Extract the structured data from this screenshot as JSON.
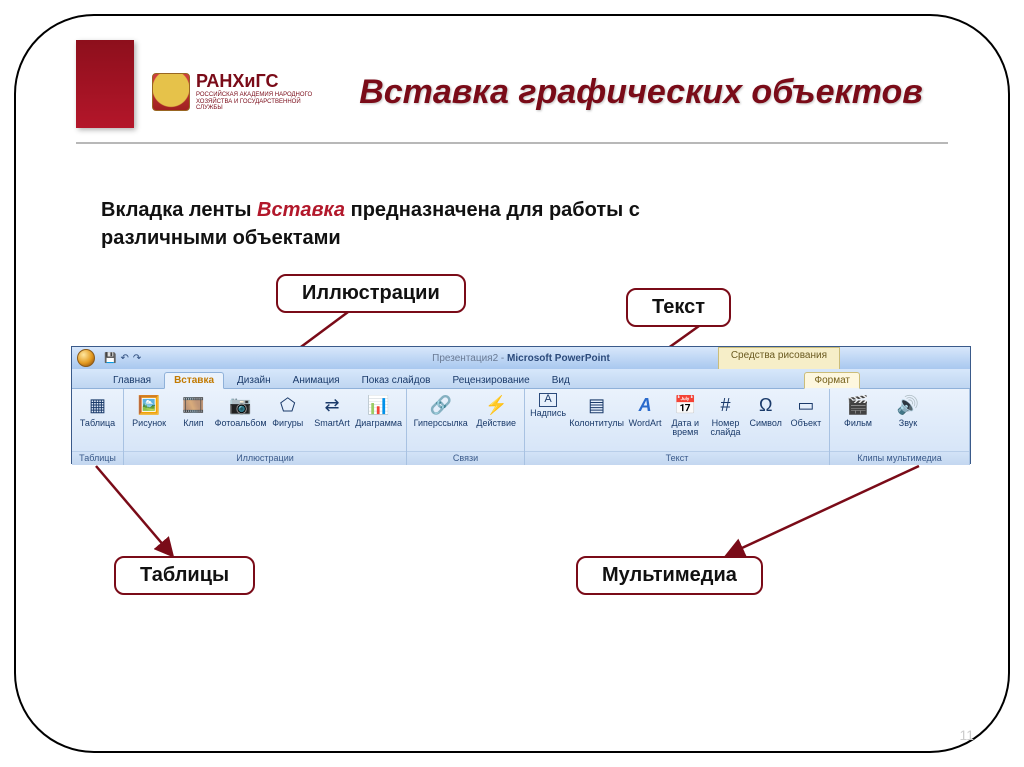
{
  "header": {
    "logo_main": "РАНХиГС",
    "title": "Вставка графических объектов"
  },
  "desc": {
    "pre": "Вкладка ленты ",
    "em": "Вставка",
    "post": " предназначена для работы  с различными объектами"
  },
  "callouts": {
    "illus": "Иллюстрации",
    "text": "Текст",
    "tables": "Таблицы",
    "media": "Мультимедиа"
  },
  "ribbon": {
    "window_title_doc": "Презентация2",
    "window_title_app": "Microsoft PowerPoint",
    "context_tab_title": "Средства рисования",
    "tabs": {
      "home": "Главная",
      "insert": "Вставка",
      "design": "Дизайн",
      "anim": "Анимация",
      "slideshow": "Показ слайдов",
      "review": "Рецензирование",
      "view": "Вид",
      "format": "Формат"
    },
    "groups": {
      "tables": {
        "label": "Таблицы",
        "items": {
          "table": "Таблица"
        }
      },
      "illus": {
        "label": "Иллюстрации",
        "items": {
          "picture": "Рисунок",
          "clip": "Клип",
          "album": "Фотоальбом",
          "shapes": "Фигуры",
          "smartart": "SmartArt",
          "chart": "Диаграмма"
        }
      },
      "links": {
        "label": "Связи",
        "items": {
          "hyper": "Гиперссылка",
          "action": "Действие"
        }
      },
      "text": {
        "label": "Текст",
        "items": {
          "textbox": "Надпись",
          "headerfooter": "Колонтитулы",
          "wordart": "WordArt",
          "datetime": "Дата и время",
          "slidenum": "Номер слайда",
          "symbol": "Символ",
          "object": "Объект"
        }
      },
      "media": {
        "label": "Клипы мультимедиа",
        "items": {
          "movie": "Фильм",
          "sound": "Звук"
        }
      }
    }
  },
  "page_number": "11"
}
